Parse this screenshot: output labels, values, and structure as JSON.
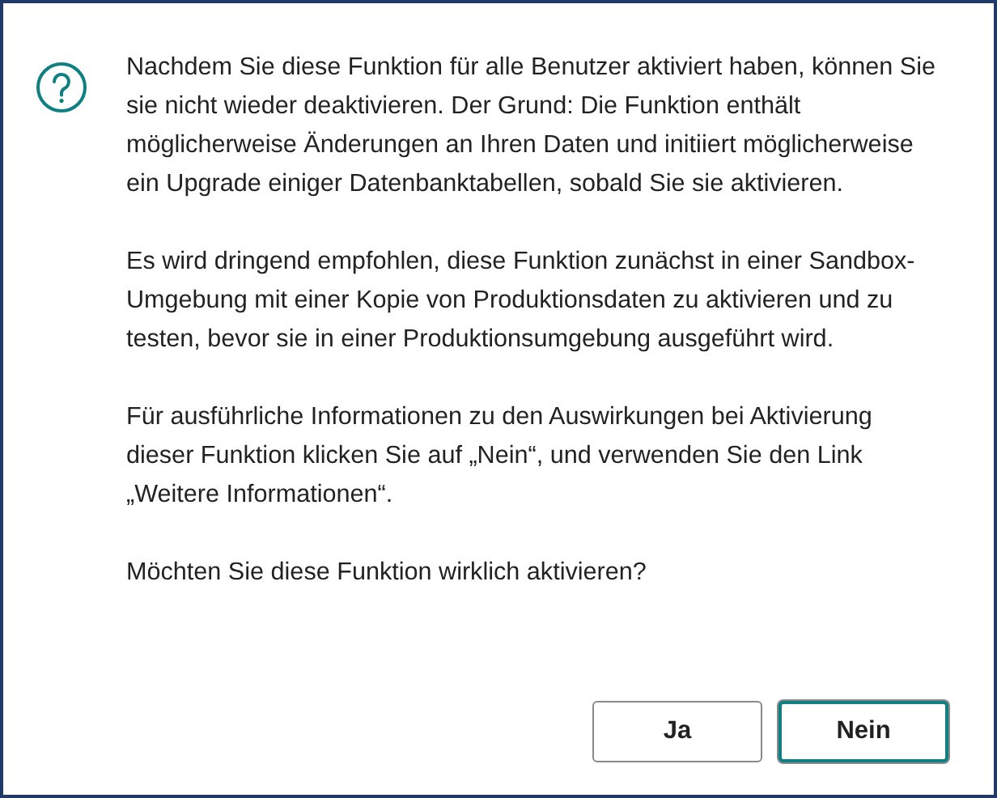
{
  "message": {
    "paragraphs": [
      "Nachdem Sie diese Funktion für alle Benutzer aktiviert haben, können Sie sie nicht wieder deaktivieren. Der Grund: Die Funktion enthält möglicherweise Änderungen an Ihren Daten und initiiert möglicherweise ein Upgrade einiger Datenbanktabellen, sobald Sie sie aktivieren.",
      "Es wird dringend empfohlen, diese Funktion zunächst in einer Sandbox-Umgebung mit einer Kopie von Produktionsdaten zu aktivieren und zu testen, bevor sie in einer Produktionsumgebung ausgeführt wird.",
      "Für ausführliche Informationen zu den Auswirkungen bei Aktivierung dieser Funktion klicken Sie auf „Nein“, und verwenden Sie den Link „Weitere Informationen“.",
      "Möchten Sie diese Funktion wirklich aktivieren?"
    ]
  },
  "buttons": [
    {
      "label": "Ja",
      "focused": false
    },
    {
      "label": "Nein",
      "focused": true
    }
  ]
}
